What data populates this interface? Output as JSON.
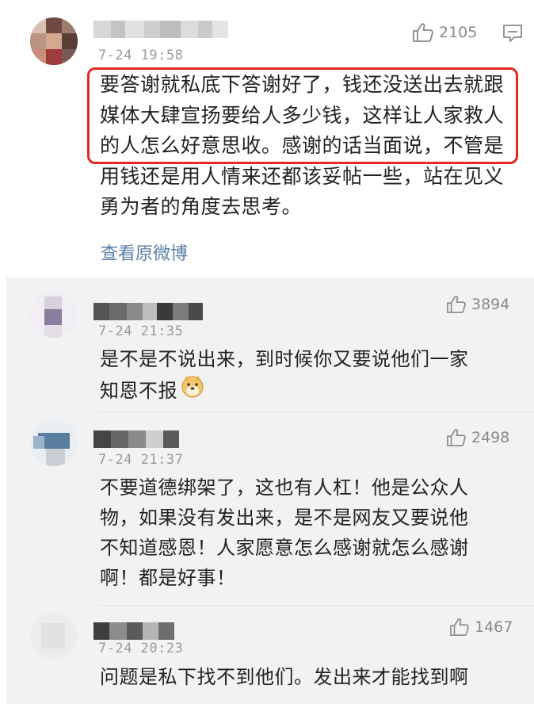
{
  "main_comment": {
    "timestamp": "7-24 19:58",
    "likes": "2105",
    "text_lines": [
      "要答谢就私底下答谢好了，钱还没送出去就跟",
      "媒体大肆宣扬要给人多少钱，这样让人家救人",
      "的人怎么好意思收。感谢的话当面说，不管是",
      "用钱还是用人情来还都该妥帖一些，站在见义",
      "勇为者的角度去思考。"
    ],
    "view_original_link": "查看原微博",
    "like_icon": "thumbs-up-icon",
    "comment_icon": "comment-icon",
    "highlight_color": "#e8271f"
  },
  "replies": [
    {
      "timestamp": "7-24 21:35",
      "likes": "3894",
      "text_lines": [
        "是不是不说出来，到时候你又要说他们一家",
        "知恩不报"
      ],
      "emoji": "doge-emoji"
    },
    {
      "timestamp": "7-24 21:37",
      "likes": "2498",
      "text_lines": [
        "不要道德绑架了，这也有人杠！他是公众人",
        "物，如果没有发出来，是不是网友又要说他",
        "不知道感恩！人家愿意怎么感谢就怎么感谢",
        "啊！都是好事！"
      ]
    },
    {
      "timestamp": "7-24 20:23",
      "likes": "1467",
      "text_lines": [
        "问题是私下找不到他们。发出来才能找到啊"
      ]
    }
  ],
  "colors": {
    "link": "#5b7fa8",
    "reply_background": "#f2f2f2",
    "muted_text": "#9a9a9a"
  }
}
